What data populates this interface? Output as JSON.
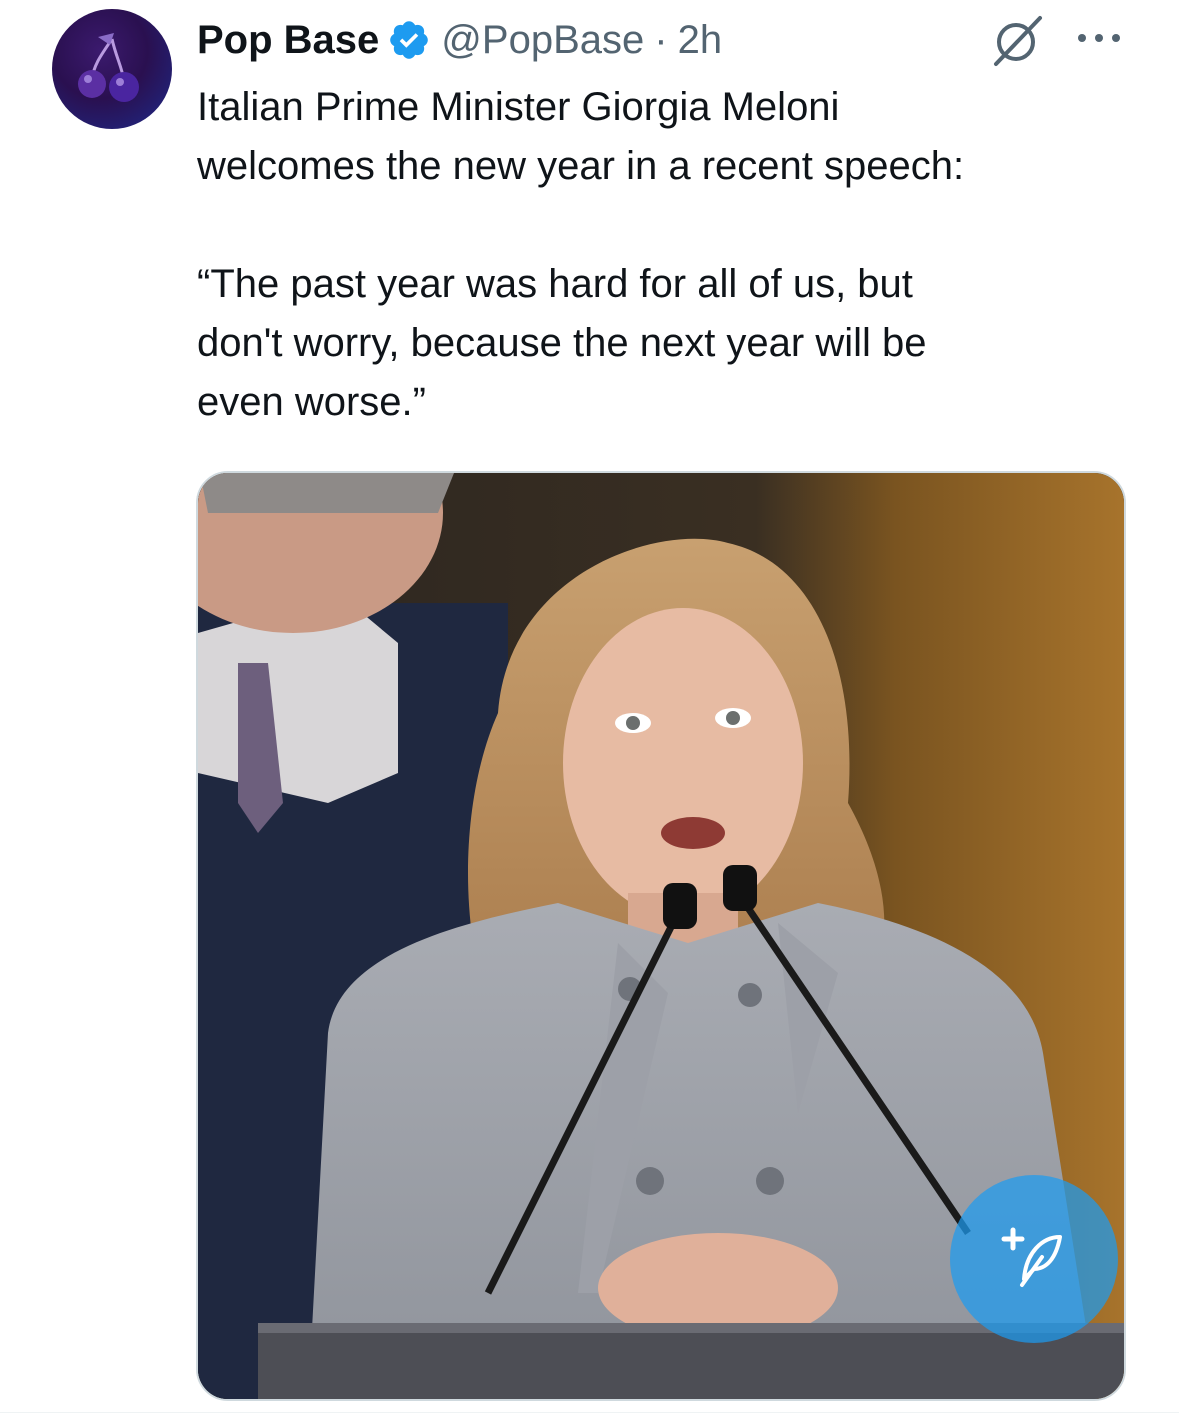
{
  "tweet": {
    "author_name": "Pop Base",
    "handle": "@PopBase",
    "separator": "·",
    "time": "2h",
    "text": "Italian Prime Minister Giorgia Meloni\nwelcomes the new year in a recent speech:\n\n“The past year was hard for all of us, but\ndon't worry, because the next year will be\neven worse.”"
  },
  "icons": {
    "avatar": "cherry-logo-icon",
    "verified": "verified-badge-icon",
    "grok": "grok-icon",
    "more": "more-icon",
    "compose": "compose-post-icon"
  },
  "colors": {
    "accent": "#1d9bf0",
    "text": "#0f1419",
    "secondary": "#536471"
  }
}
